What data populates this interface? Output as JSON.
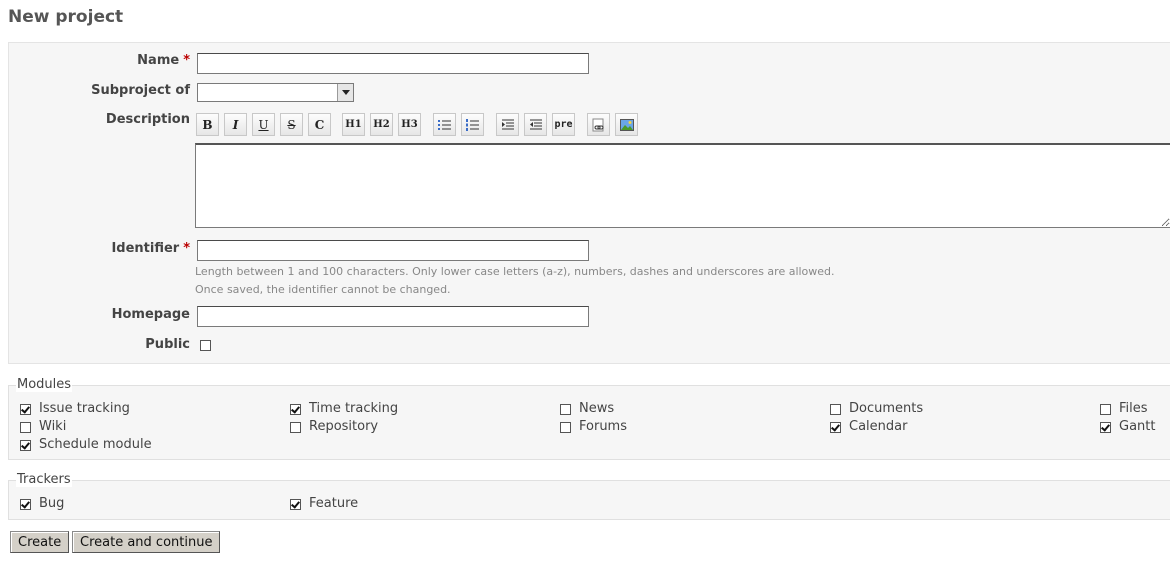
{
  "page": {
    "title": "New project"
  },
  "form": {
    "name": {
      "label": "Name",
      "required_mark": "*",
      "value": ""
    },
    "subproject": {
      "label": "Subproject of",
      "value": ""
    },
    "description": {
      "label": "Description",
      "toolbar": [
        {
          "name": "bold-icon",
          "glyph": "B"
        },
        {
          "name": "italic-icon",
          "glyph": "I"
        },
        {
          "name": "underline-icon",
          "glyph": "U"
        },
        {
          "name": "strikethrough-icon",
          "glyph": "S"
        },
        {
          "name": "code-icon",
          "glyph": "C"
        },
        {
          "name": "heading-1-icon",
          "glyph": "H1"
        },
        {
          "name": "heading-2-icon",
          "glyph": "H2"
        },
        {
          "name": "heading-3-icon",
          "glyph": "H3"
        },
        {
          "name": "unordered-list-icon",
          "glyph": ""
        },
        {
          "name": "ordered-list-icon",
          "glyph": ""
        },
        {
          "name": "quote-icon",
          "glyph": ""
        },
        {
          "name": "unquote-icon",
          "glyph": ""
        },
        {
          "name": "preformatted-icon",
          "glyph": "pre"
        },
        {
          "name": "link-icon",
          "glyph": ""
        },
        {
          "name": "image-icon",
          "glyph": ""
        }
      ],
      "value": ""
    },
    "identifier": {
      "label": "Identifier",
      "required_mark": "*",
      "value": "",
      "hint_1": "Length between 1 and 100 characters. Only lower case letters (a-z), numbers, dashes and underscores are allowed.",
      "hint_2": "Once saved, the identifier cannot be changed."
    },
    "homepage": {
      "label": "Homepage",
      "value": ""
    },
    "public": {
      "label": "Public",
      "checked": false
    }
  },
  "modules": {
    "legend": "Modules",
    "items": [
      {
        "label": "Issue tracking",
        "checked": true
      },
      {
        "label": "Time tracking",
        "checked": true
      },
      {
        "label": "News",
        "checked": false
      },
      {
        "label": "Documents",
        "checked": false
      },
      {
        "label": "Files",
        "checked": false
      },
      {
        "label": "Wiki",
        "checked": false
      },
      {
        "label": "Repository",
        "checked": false
      },
      {
        "label": "Forums",
        "checked": false
      },
      {
        "label": "Calendar",
        "checked": true
      },
      {
        "label": "Gantt",
        "checked": true
      },
      {
        "label": "Schedule module",
        "checked": true
      }
    ]
  },
  "trackers": {
    "legend": "Trackers",
    "items": [
      {
        "label": "Bug",
        "checked": true
      },
      {
        "label": "Feature",
        "checked": true
      }
    ]
  },
  "actions": {
    "create": "Create",
    "create_continue": "Create and continue"
  }
}
